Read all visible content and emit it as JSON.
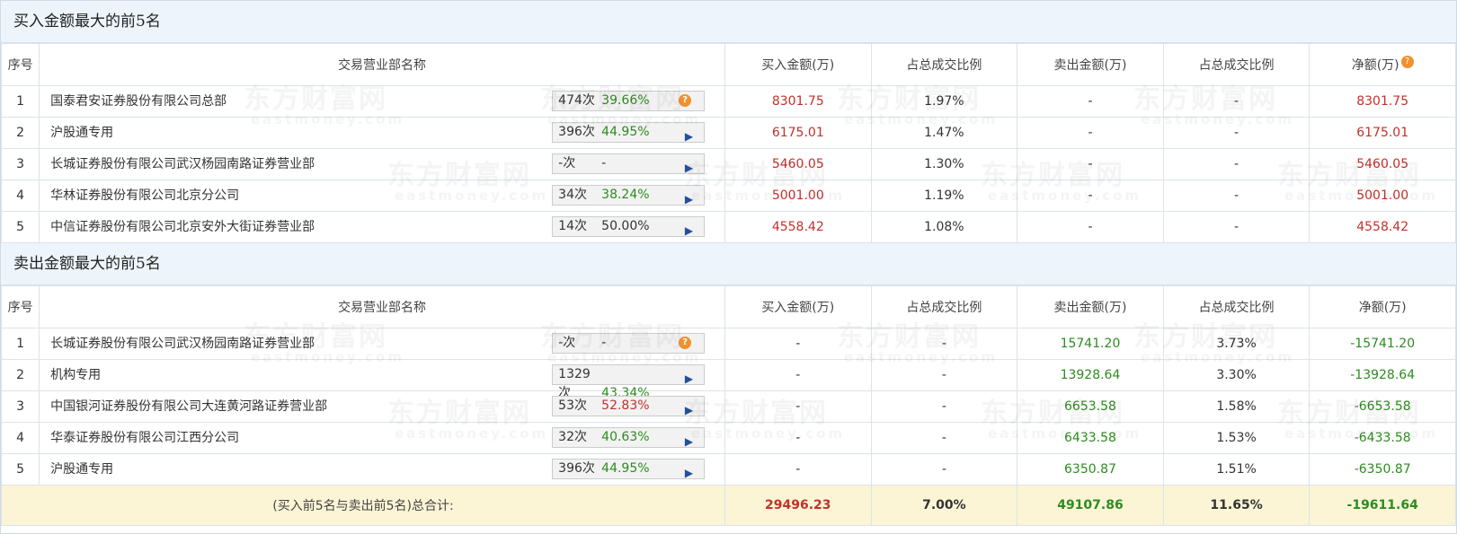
{
  "buy_section": {
    "title": "买入金额最大的前5名",
    "headers": [
      "序号",
      "交易营业部名称",
      "买入金额(万)",
      "占总成交比例",
      "卖出金额(万)",
      "占总成交比例",
      "净额(万)"
    ],
    "rows": [
      {
        "rank": "1",
        "name": "国泰君安证券股份有限公司总部",
        "times": "474次",
        "pct": "39.66%",
        "pct_color": "green",
        "buy": "8301.75",
        "buy_ratio": "1.97%",
        "sell": "-",
        "sell_ratio": "-",
        "net": "8301.75",
        "badge": "help-icon"
      },
      {
        "rank": "2",
        "name": "沪股通专用",
        "times": "396次",
        "pct": "44.95%",
        "pct_color": "green",
        "buy": "6175.01",
        "buy_ratio": "1.47%",
        "sell": "-",
        "sell_ratio": "-",
        "net": "6175.01",
        "badge": "arrow-right-icon"
      },
      {
        "rank": "3",
        "name": "长城证券股份有限公司武汉杨园南路证券营业部",
        "times": "-次",
        "pct": "-",
        "pct_color": "dark",
        "buy": "5460.05",
        "buy_ratio": "1.30%",
        "sell": "-",
        "sell_ratio": "-",
        "net": "5460.05",
        "badge": "arrow-right-icon"
      },
      {
        "rank": "4",
        "name": "华林证券股份有限公司北京分公司",
        "times": "34次",
        "pct": "38.24%",
        "pct_color": "green",
        "buy": "5001.00",
        "buy_ratio": "1.19%",
        "sell": "-",
        "sell_ratio": "-",
        "net": "5001.00",
        "badge": "arrow-right-icon"
      },
      {
        "rank": "5",
        "name": "中信证券股份有限公司北京安外大街证券营业部",
        "times": "14次",
        "pct": "50.00%",
        "pct_color": "dark",
        "buy": "4558.42",
        "buy_ratio": "1.08%",
        "sell": "-",
        "sell_ratio": "-",
        "net": "4558.42",
        "badge": "arrow-right-icon"
      }
    ]
  },
  "sell_section": {
    "title": "卖出金额最大的前5名",
    "headers": [
      "序号",
      "交易营业部名称",
      "买入金额(万)",
      "占总成交比例",
      "卖出金额(万)",
      "占总成交比例",
      "净额(万)"
    ],
    "rows": [
      {
        "rank": "1",
        "name": "长城证券股份有限公司武汉杨园南路证券营业部",
        "times": "-次",
        "pct": "-",
        "pct_color": "dark",
        "buy": "-",
        "buy_ratio": "-",
        "sell": "15741.20",
        "sell_ratio": "3.73%",
        "net": "-15741.20",
        "badge": "help-icon"
      },
      {
        "rank": "2",
        "name": "机构专用",
        "times": "1329次",
        "pct": "43.34%",
        "pct_color": "green",
        "buy": "-",
        "buy_ratio": "-",
        "sell": "13928.64",
        "sell_ratio": "3.30%",
        "net": "-13928.64",
        "badge": "arrow-right-icon"
      },
      {
        "rank": "3",
        "name": "中国银河证券股份有限公司大连黄河路证券营业部",
        "times": "53次",
        "pct": "52.83%",
        "pct_color": "red",
        "buy": "-",
        "buy_ratio": "-",
        "sell": "6653.58",
        "sell_ratio": "1.58%",
        "net": "-6653.58",
        "badge": "arrow-right-icon"
      },
      {
        "rank": "4",
        "name": "华泰证券股份有限公司江西分公司",
        "times": "32次",
        "pct": "40.63%",
        "pct_color": "green",
        "buy": "-",
        "buy_ratio": "-",
        "sell": "6433.58",
        "sell_ratio": "1.53%",
        "net": "-6433.58",
        "badge": "arrow-right-icon"
      },
      {
        "rank": "5",
        "name": "沪股通专用",
        "times": "396次",
        "pct": "44.95%",
        "pct_color": "green",
        "buy": "-",
        "buy_ratio": "-",
        "sell": "6350.87",
        "sell_ratio": "1.51%",
        "net": "-6350.87",
        "badge": "arrow-right-icon"
      }
    ]
  },
  "total": {
    "label": "(买入前5名与卖出前5名)总合计:",
    "buy": "29496.23",
    "buy_ratio": "7.00%",
    "sell": "49107.86",
    "sell_ratio": "11.65%",
    "net": "-19611.64"
  },
  "watermark": {
    "line1": "东方财富网",
    "line2": "eastmoney.com"
  },
  "colors": {
    "red": "#c4302b",
    "green": "#2e8b20",
    "header_bg": "#edf4fb",
    "total_bg": "#fbf5d6",
    "badge": "#f0912e",
    "arrow": "#23509b"
  }
}
